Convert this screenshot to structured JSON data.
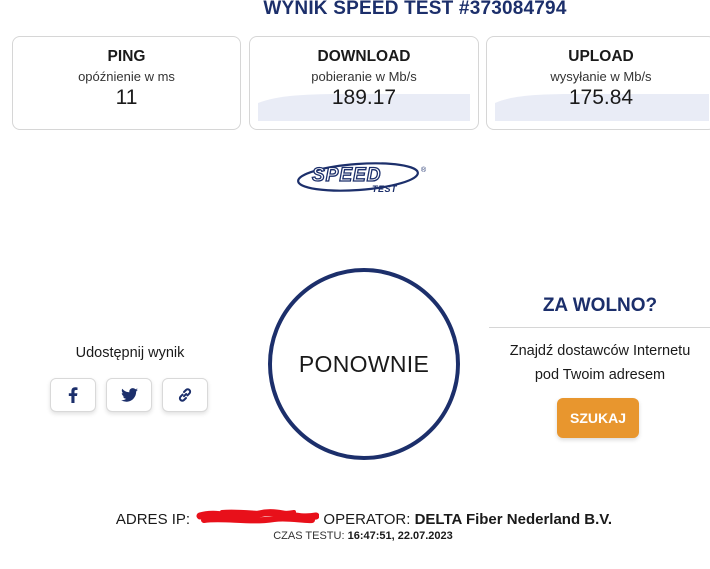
{
  "header": {
    "title": "WYNIK SPEED TEST #373084794"
  },
  "metrics": {
    "ping": {
      "label": "PING",
      "sub": "opóźnienie w ms",
      "value": "11"
    },
    "download": {
      "label": "DOWNLOAD",
      "sub": "pobieranie w Mb/s",
      "value": "189.17"
    },
    "upload": {
      "label": "UPLOAD",
      "sub": "wysyłanie w Mb/s",
      "value": "175.84"
    }
  },
  "logo": {
    "main": "SPEED",
    "sub": "TEST",
    "mark": "®"
  },
  "share": {
    "label": "Udostępnij wynik",
    "buttons": [
      {
        "icon": "facebook-icon"
      },
      {
        "icon": "twitter-icon"
      },
      {
        "icon": "link-icon"
      }
    ]
  },
  "again_button": {
    "label": "PONOWNIE"
  },
  "slow_panel": {
    "title": "ZA WOLNO?",
    "line1": "Znajdź dostawców Internetu",
    "line2": "pod Twoim adresem",
    "button": "SZUKAJ"
  },
  "footer": {
    "ip_label": "ADRES IP:",
    "operator_label": "OPERATOR:",
    "operator_value": "DELTA Fiber Nederland B.V.",
    "time_label": "CZAS TESTU:",
    "time_value": "16:47:51, 22.07.2023"
  },
  "colors": {
    "navy": "#1c2f6b",
    "orange": "#e8962e",
    "wave": "#e9ecf6",
    "redaction": "#e8101a"
  }
}
